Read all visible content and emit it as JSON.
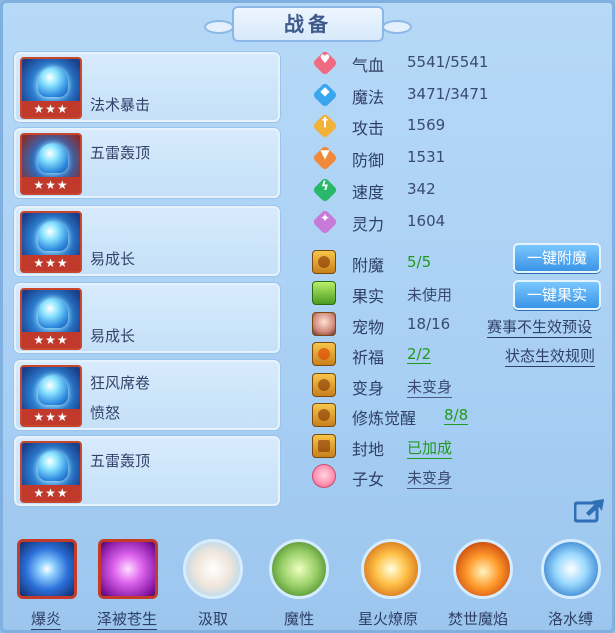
{
  "title": "战备",
  "cards": [
    {
      "line1": "法术暴击",
      "line2": "",
      "stars": "★★★"
    },
    {
      "line1": "五雷轰顶",
      "line2": "",
      "stars": "★★★"
    },
    {
      "line1": "易成长",
      "line2": "",
      "stars": "★★★"
    },
    {
      "line1": "易成长",
      "line2": "",
      "stars": "★★★"
    },
    {
      "line1": "狂风席卷",
      "line2": "愤怒",
      "stars": "★★★"
    },
    {
      "line1": "五雷轰顶",
      "line2": "",
      "stars": "★★★"
    }
  ],
  "stats": [
    {
      "name": "气血",
      "value": "5541/5541",
      "icon": "heart-icon",
      "color": "#f06a82"
    },
    {
      "name": "魔法",
      "value": "3471/3471",
      "icon": "mana-icon",
      "color": "#3aa6f0"
    },
    {
      "name": "攻击",
      "value": "1569",
      "icon": "attack-icon",
      "color": "#f2b237"
    },
    {
      "name": "防御",
      "value": "1531",
      "icon": "defense-icon",
      "color": "#f08a3a"
    },
    {
      "name": "速度",
      "value": "342",
      "icon": "speed-icon",
      "color": "#29b86a"
    },
    {
      "name": "灵力",
      "value": "1604",
      "icon": "spirit-icon",
      "color": "#c77ad8"
    }
  ],
  "props": [
    {
      "name": "附魔",
      "value": "5/5",
      "style": "green"
    },
    {
      "name": "果实",
      "value": "未使用",
      "style": "plain"
    },
    {
      "name": "宠物",
      "value": "18/16",
      "style": "plain"
    },
    {
      "name": "祈福",
      "value": "2/2",
      "style": "green"
    },
    {
      "name": "变身",
      "value": "未变身",
      "style": "underline"
    },
    {
      "name": "修炼觉醒",
      "value": "8/8",
      "style": "green"
    },
    {
      "name": "封地",
      "value": "已加成",
      "style": "green"
    },
    {
      "name": "子女",
      "value": "未变身",
      "style": "underline"
    }
  ],
  "buttons": {
    "enchant": "一键附魔",
    "fruit": "一键果实"
  },
  "links": {
    "event": "赛事不生效预设",
    "status_rules": "状态生效规则"
  },
  "skills": [
    {
      "name": "爆炎",
      "color": "#2b6fd8"
    },
    {
      "name": "泽被苍生",
      "color": "#c23bd8"
    },
    {
      "name": "汲取",
      "color": "#e8e2d8"
    },
    {
      "name": "魔性",
      "color": "#9ad06a"
    },
    {
      "name": "星火燎原",
      "color": "#f0a030"
    },
    {
      "name": "焚世魔焰",
      "color": "#f07a2a"
    },
    {
      "name": "洛水缚",
      "color": "#4aa8e8"
    }
  ]
}
